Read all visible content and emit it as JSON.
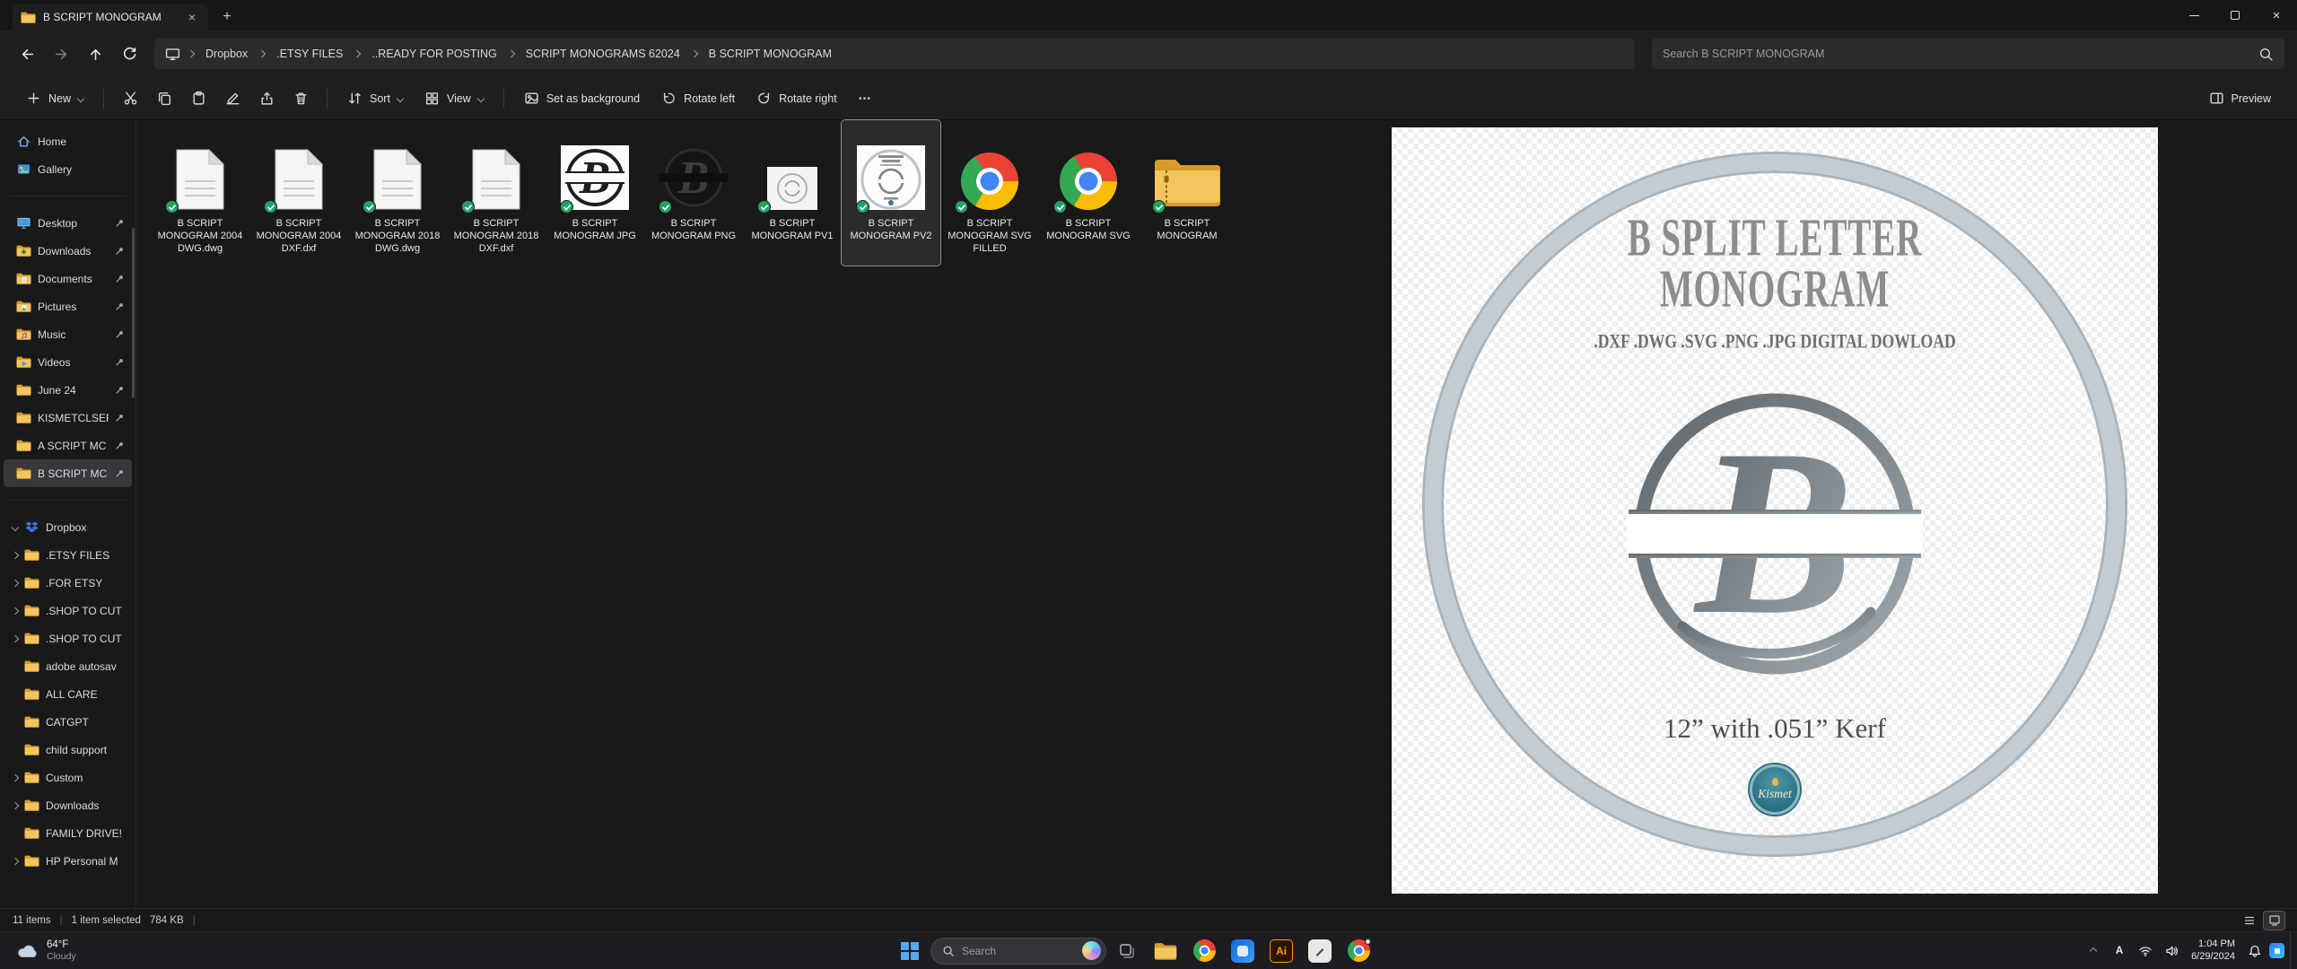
{
  "titlebar": {
    "tab_title": "B SCRIPT MONOGRAM"
  },
  "navbar": {
    "breadcrumbs": [
      "Dropbox",
      ".ETSY FILES",
      "..READY FOR POSTING",
      "SCRIPT MONOGRAMS 62024",
      "B SCRIPT MONOGRAM"
    ],
    "search_placeholder": "Search B SCRIPT MONOGRAM"
  },
  "toolbar": {
    "new_label": "New",
    "sort_label": "Sort",
    "view_label": "View",
    "set_as_background_label": "Set as background",
    "rotate_left_label": "Rotate left",
    "rotate_right_label": "Rotate right",
    "preview_label": "Preview"
  },
  "sidebar": {
    "home_label": "Home",
    "gallery_label": "Gallery",
    "pinned": [
      {
        "label": "Desktop",
        "icon": "desktop-icon",
        "pinned": true
      },
      {
        "label": "Downloads",
        "icon": "downloads-folder-icon",
        "pinned": true
      },
      {
        "label": "Documents",
        "icon": "documents-folder-icon",
        "pinned": true
      },
      {
        "label": "Pictures",
        "icon": "pictures-folder-icon",
        "pinned": true
      },
      {
        "label": "Music",
        "icon": "music-folder-icon",
        "pinned": true
      },
      {
        "label": "Videos",
        "icon": "videos-folder-icon",
        "pinned": true
      },
      {
        "label": "June 24",
        "icon": "folder-icon",
        "pinned": true
      },
      {
        "label": "KISMETCLSEF",
        "icon": "folder-icon",
        "pinned": true
      },
      {
        "label": "A SCRIPT MC",
        "icon": "folder-icon",
        "pinned": true
      },
      {
        "label": "B SCRIPT MC",
        "icon": "folder-icon",
        "pinned": true,
        "selected": true
      }
    ],
    "dropbox_label": "Dropbox",
    "tree": [
      {
        "label": ".ETSY FILES",
        "expandable": true
      },
      {
        "label": ".FOR ETSY",
        "expandable": true
      },
      {
        "label": ".SHOP TO CUT",
        "expandable": true
      },
      {
        "label": ".SHOP TO CUT",
        "expandable": true
      },
      {
        "label": "adobe autosav",
        "expandable": false
      },
      {
        "label": "ALL CARE",
        "expandable": false
      },
      {
        "label": "CATGPT",
        "expandable": false
      },
      {
        "label": "child support",
        "expandable": false
      },
      {
        "label": "Custom",
        "expandable": true
      },
      {
        "label": "Downloads",
        "expandable": true
      },
      {
        "label": "FAMILY DRIVE!",
        "expandable": false
      },
      {
        "label": "HP Personal M",
        "expandable": true
      }
    ]
  },
  "files": [
    {
      "name": "B SCRIPT MONOGRAM 2004 DWG.dwg",
      "icon": "document-icon",
      "synced": true
    },
    {
      "name": "B SCRIPT MONOGRAM 2004 DXF.dxf",
      "icon": "document-icon",
      "synced": true
    },
    {
      "name": "B SCRIPT MONOGRAM 2018 DWG.dwg",
      "icon": "document-icon",
      "synced": true
    },
    {
      "name": "B SCRIPT MONOGRAM 2018 DXF.dxf",
      "icon": "document-icon",
      "synced": true
    },
    {
      "name": "B SCRIPT MONOGRAM JPG",
      "icon": "monogram-thumbnail",
      "synced": true
    },
    {
      "name": "B SCRIPT MONOGRAM PNG",
      "icon": "monogram-thumbnail-dark",
      "synced": true
    },
    {
      "name": "B SCRIPT MONOGRAM PV1",
      "icon": "preview-thumbnail-small",
      "synced": true
    },
    {
      "name": "B SCRIPT MONOGRAM PV2",
      "icon": "preview-thumbnail",
      "synced": true,
      "selected": true
    },
    {
      "name": "B SCRIPT MONOGRAM SVG FILLED",
      "icon": "chrome-icon",
      "synced": true
    },
    {
      "name": "B SCRIPT MONOGRAM SVG",
      "icon": "chrome-icon",
      "synced": true
    },
    {
      "name": "B SCRIPT MONOGRAM",
      "icon": "zip-folder-icon",
      "synced": true
    }
  ],
  "preview": {
    "title_line1": "B SPLIT LETTER",
    "title_line2": "MONOGRAM",
    "formats_line": ".DXF .DWG .SVG .PNG .JPG DIGITAL DOWLOAD",
    "monogram_letter": "B",
    "kerf_line": "12” with .051” Kerf",
    "badge_text": "Kismet"
  },
  "statusbar": {
    "items_count": "11 items",
    "selection": "1 item selected",
    "selection_size": "784 KB"
  },
  "taskbar": {
    "weather_temp": "64°F",
    "weather_condition": "Cloudy",
    "search_placeholder": "Search",
    "illustrator_label": "Ai",
    "ime_letter": "A",
    "time": "1:04 PM",
    "date": "6/29/2024"
  },
  "colors": {
    "sync_badge_green": "#21a366",
    "folder_yellow": "#f3c55e",
    "selection_gray": "#37373c",
    "monogram_silver": "#9fa8ae"
  }
}
